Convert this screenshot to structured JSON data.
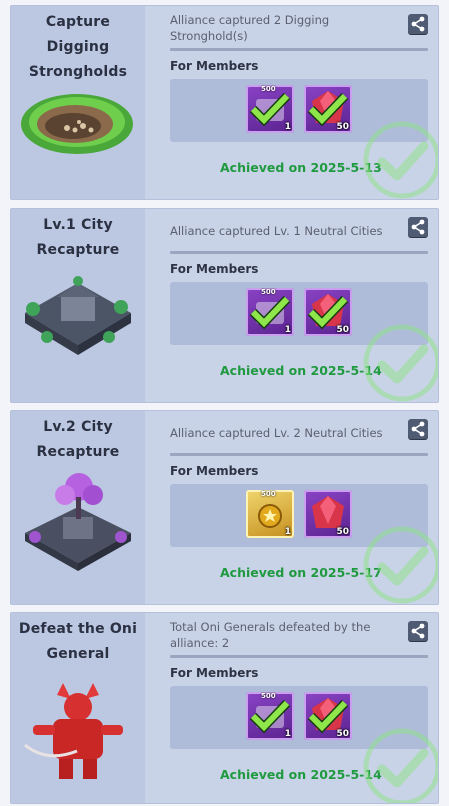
{
  "achievements": [
    {
      "title_line1": "Capture Digging",
      "title_line2": "Strongholds",
      "description": "Alliance captured 2 Digging Stronghold(s)",
      "members_label": "For Members",
      "rewards": [
        {
          "icon": "speedup-chest-icon",
          "top_value": "500",
          "count": "1"
        },
        {
          "icon": "red-gem-icon",
          "top_value": "",
          "count": "50"
        }
      ],
      "achieved_text": "Achieved on 2025-5-13",
      "claimed": true
    },
    {
      "title_line1": "Lv.1 City",
      "title_line2": "Recapture",
      "description": "Alliance captured Lv. 1 Neutral Cities",
      "members_label": "For Members",
      "rewards": [
        {
          "icon": "speedup-chest-icon",
          "top_value": "500",
          "count": "1"
        },
        {
          "icon": "red-gem-icon",
          "top_value": "",
          "count": "50"
        }
      ],
      "achieved_text": "Achieved on 2025-5-14",
      "claimed": true
    },
    {
      "title_line1": "Lv.2 City",
      "title_line2": "Recapture",
      "description": "Alliance captured Lv. 2 Neutral Cities",
      "members_label": "For Members",
      "rewards": [
        {
          "icon": "gold-medal-icon",
          "top_value": "500",
          "count": "1"
        },
        {
          "icon": "red-gem-icon",
          "top_value": "",
          "count": "50"
        }
      ],
      "achieved_text": "Achieved on 2025-5-17",
      "claimed": false
    },
    {
      "title_line1": "Defeat the Oni",
      "title_line2": "General",
      "description": "Total Oni Generals defeated by the alliance: 2",
      "members_label": "For Members",
      "rewards": [
        {
          "icon": "speedup-chest-icon",
          "top_value": "500",
          "count": "1"
        },
        {
          "icon": "red-gem-icon",
          "top_value": "",
          "count": "50"
        }
      ],
      "achieved_text": "Achieved on 2025-5-14",
      "claimed": true
    }
  ],
  "colors": {
    "card_bg": "#c9d3e8",
    "achieved_green": "#1f9a3f",
    "item_purple": "#7a37b5"
  }
}
